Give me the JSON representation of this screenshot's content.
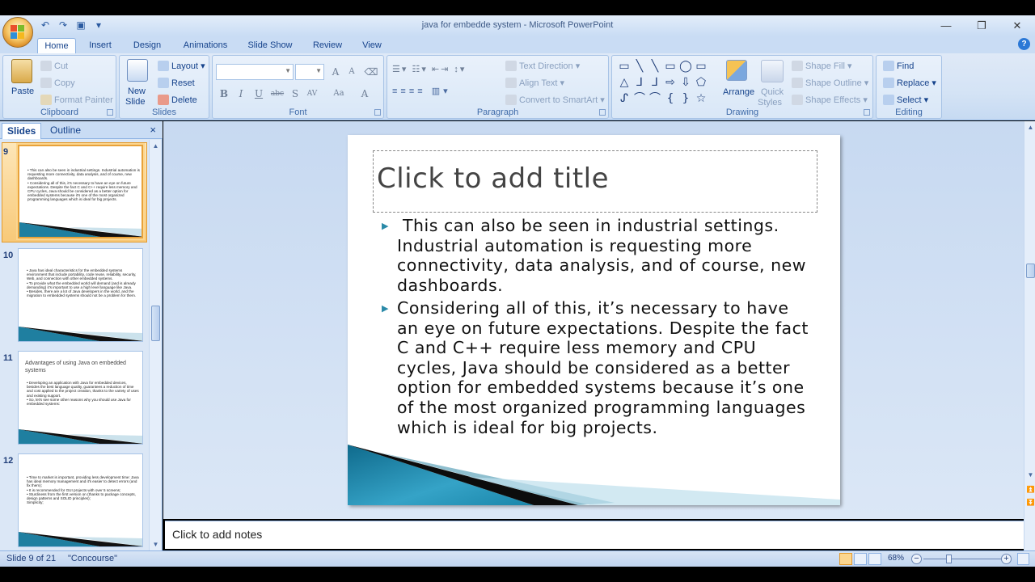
{
  "window": {
    "title": "java for embedde system - Microsoft PowerPoint",
    "controls": [
      "—",
      "❐",
      "✕"
    ]
  },
  "qat": [
    "↶",
    "↷",
    "▣",
    "▾"
  ],
  "tabs": [
    "Home",
    "Insert",
    "Design",
    "Animations",
    "Slide Show",
    "Review",
    "View"
  ],
  "ribbon": {
    "clipboard": {
      "label": "Clipboard",
      "paste": "Paste",
      "cut": "Cut",
      "copy": "Copy",
      "format_painter": "Format Painter"
    },
    "slides": {
      "label": "Slides",
      "new_slide_1": "New",
      "new_slide_2": "Slide",
      "layout": "Layout",
      "reset": "Reset",
      "delete": "Delete"
    },
    "font": {
      "label": "Font",
      "bold": "B",
      "italic": "I",
      "underline": "U",
      "strike": "abc",
      "shadow": "S",
      "spacing": "AV",
      "case": "Aa",
      "color": "A",
      "grow": "A",
      "shrink": "A",
      "clear": "⌫"
    },
    "paragraph": {
      "label": "Paragraph",
      "text_direction": "Text Direction",
      "align_text": "Align Text",
      "convert_smartart": "Convert to SmartArt"
    },
    "drawing": {
      "label": "Drawing",
      "arrange": "Arrange",
      "quick_styles_1": "Quick",
      "quick_styles_2": "Styles",
      "shape_fill": "Shape Fill",
      "shape_outline": "Shape Outline",
      "shape_effects": "Shape Effects",
      "shapes_row1": [
        "▭",
        "╲",
        "╲",
        "▭",
        "◯",
        "▭"
      ],
      "shapes_row2": [
        "△",
        "⅃",
        "⅃",
        "⇨",
        "⇩",
        "⬠"
      ],
      "shapes_row3": [
        "ᔑ",
        "⌒",
        "⌒",
        "{",
        "}",
        "☆"
      ]
    },
    "editing": {
      "label": "Editing",
      "find": "Find",
      "replace": "Replace",
      "select": "Select"
    }
  },
  "left_pane": {
    "tabs": [
      "Slides",
      "Outline"
    ],
    "close": "×",
    "thumbnails": [
      {
        "number": "9",
        "title": "",
        "body": "• This can also be seen in industrial settings. Industrial automation is requesting more connectivity, data analysis, and of course, new dashboards.\n• Considering all of this, it's necessary to have an eye on future expectations. Despite the fact C and C++ require less memory and CPU cycles, Java should be considered as a better option for embedded systems because it's one of the most organized programming languages which is ideal for big projects."
      },
      {
        "number": "10",
        "title": "",
        "body": "• Java has ideal characteristics for the embedded systems environment that include portability, code reuse, reliability, security, Web, and connection with other embedded systems.\n• To provide what the embedded world will demand (and is already demanding) it's important to use a high level language like Java.\n• Besides, there are a lot of Java developers in the world, and the migration to embedded systems should not be a problem for them."
      },
      {
        "number": "11",
        "title": "Advantages of using Java on embedded systems",
        "body": "• Developing an application with Java for embedded devices, besides the best language quality, guarantees a reduction of time and cost applied to the project creation, thanks to the variety of uses and existing support.\n• So, let's see some other reasons why you should use Java for embedded systems:"
      },
      {
        "number": "12",
        "title": "",
        "body": "• Time to market is important, providing less development time: Java has ideal memory management and it's easier to detect errors (and fix them);\n• It is recommended for GUI projects with over 5 screens;\n• Sturdiness from the first version on (thanks to package concepts, design patterns and SOLID principles);\n  Simplicity;"
      }
    ]
  },
  "slide": {
    "title_placeholder": "Click to add title",
    "bullets": [
      " This can also be seen in industrial settings. Industrial automation is requesting more connectivity, data analysis, and of course, new dashboards.",
      "Considering all of this, it’s necessary to have an eye on future expectations. Despite the fact C and C++ require less memory and CPU cycles, Java should be considered as a better option for embedded systems because it’s one of the most organized programming languages which is ideal for big projects."
    ]
  },
  "notes": {
    "placeholder": "Click to add notes"
  },
  "status": {
    "slide_info": "Slide 9 of 21",
    "theme": "\"Concourse\"",
    "zoom": "68%",
    "zoom_minus": "−",
    "zoom_plus": "+"
  }
}
